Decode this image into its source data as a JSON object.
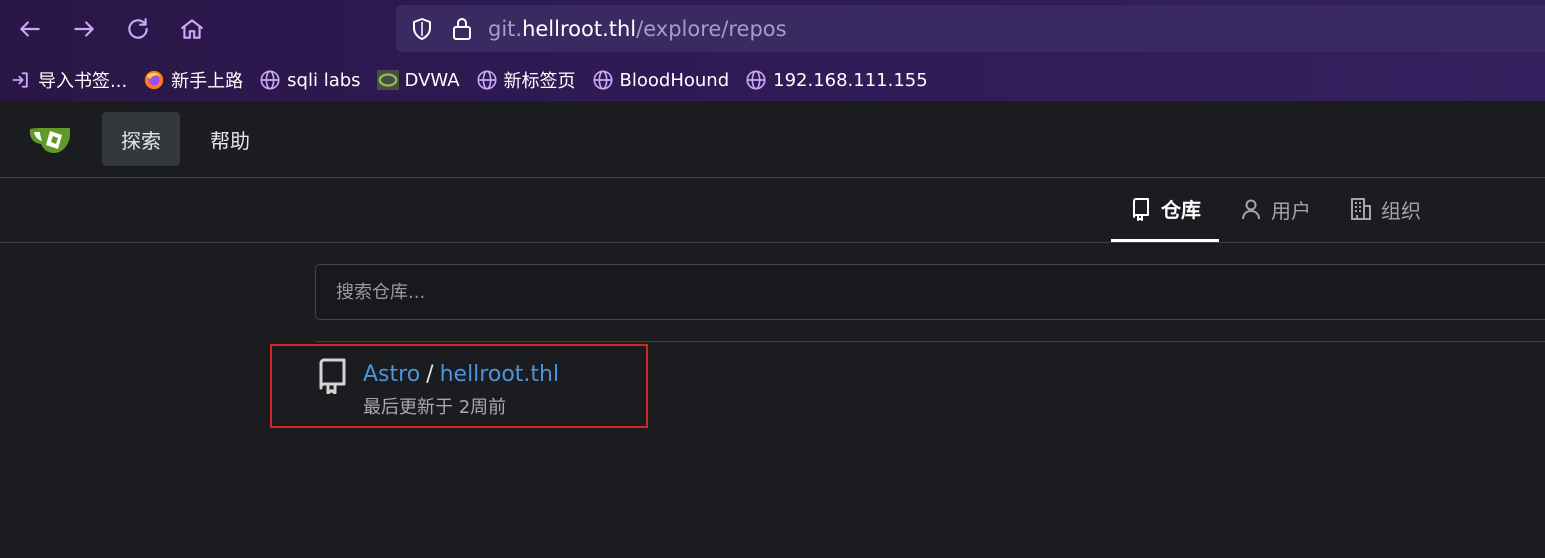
{
  "browser": {
    "url_prefix": "git.",
    "url_host": "hellroot.thl",
    "url_path": "/explore/repos",
    "bookmarks": [
      {
        "label": "导入书签...",
        "icon": "import-icon"
      },
      {
        "label": "新手上路",
        "icon": "firefox-icon"
      },
      {
        "label": "sqli labs",
        "icon": "globe-icon"
      },
      {
        "label": "DVWA",
        "icon": "dvwa-icon"
      },
      {
        "label": "新标签页",
        "icon": "globe-icon"
      },
      {
        "label": "BloodHound",
        "icon": "globe-icon"
      },
      {
        "label": "192.168.111.155",
        "icon": "globe-icon"
      }
    ],
    "accent": "#c9a8f5"
  },
  "header": {
    "nav": [
      {
        "label": "探索",
        "active": true
      },
      {
        "label": "帮助",
        "active": false
      }
    ]
  },
  "tabs": [
    {
      "label": "仓库",
      "icon": "repo-icon",
      "active": true
    },
    {
      "label": "用户",
      "icon": "user-icon",
      "active": false
    },
    {
      "label": "组织",
      "icon": "organization-icon",
      "active": false
    }
  ],
  "search": {
    "placeholder": "搜索仓库..."
  },
  "results": [
    {
      "owner": "Astro",
      "separator": "/",
      "name": "hellroot.thl",
      "updated": "最后更新于 2周前"
    }
  ],
  "colors": {
    "link": "#4c93dd",
    "highlight_border": "#d32626",
    "background": "#1a1c20"
  }
}
